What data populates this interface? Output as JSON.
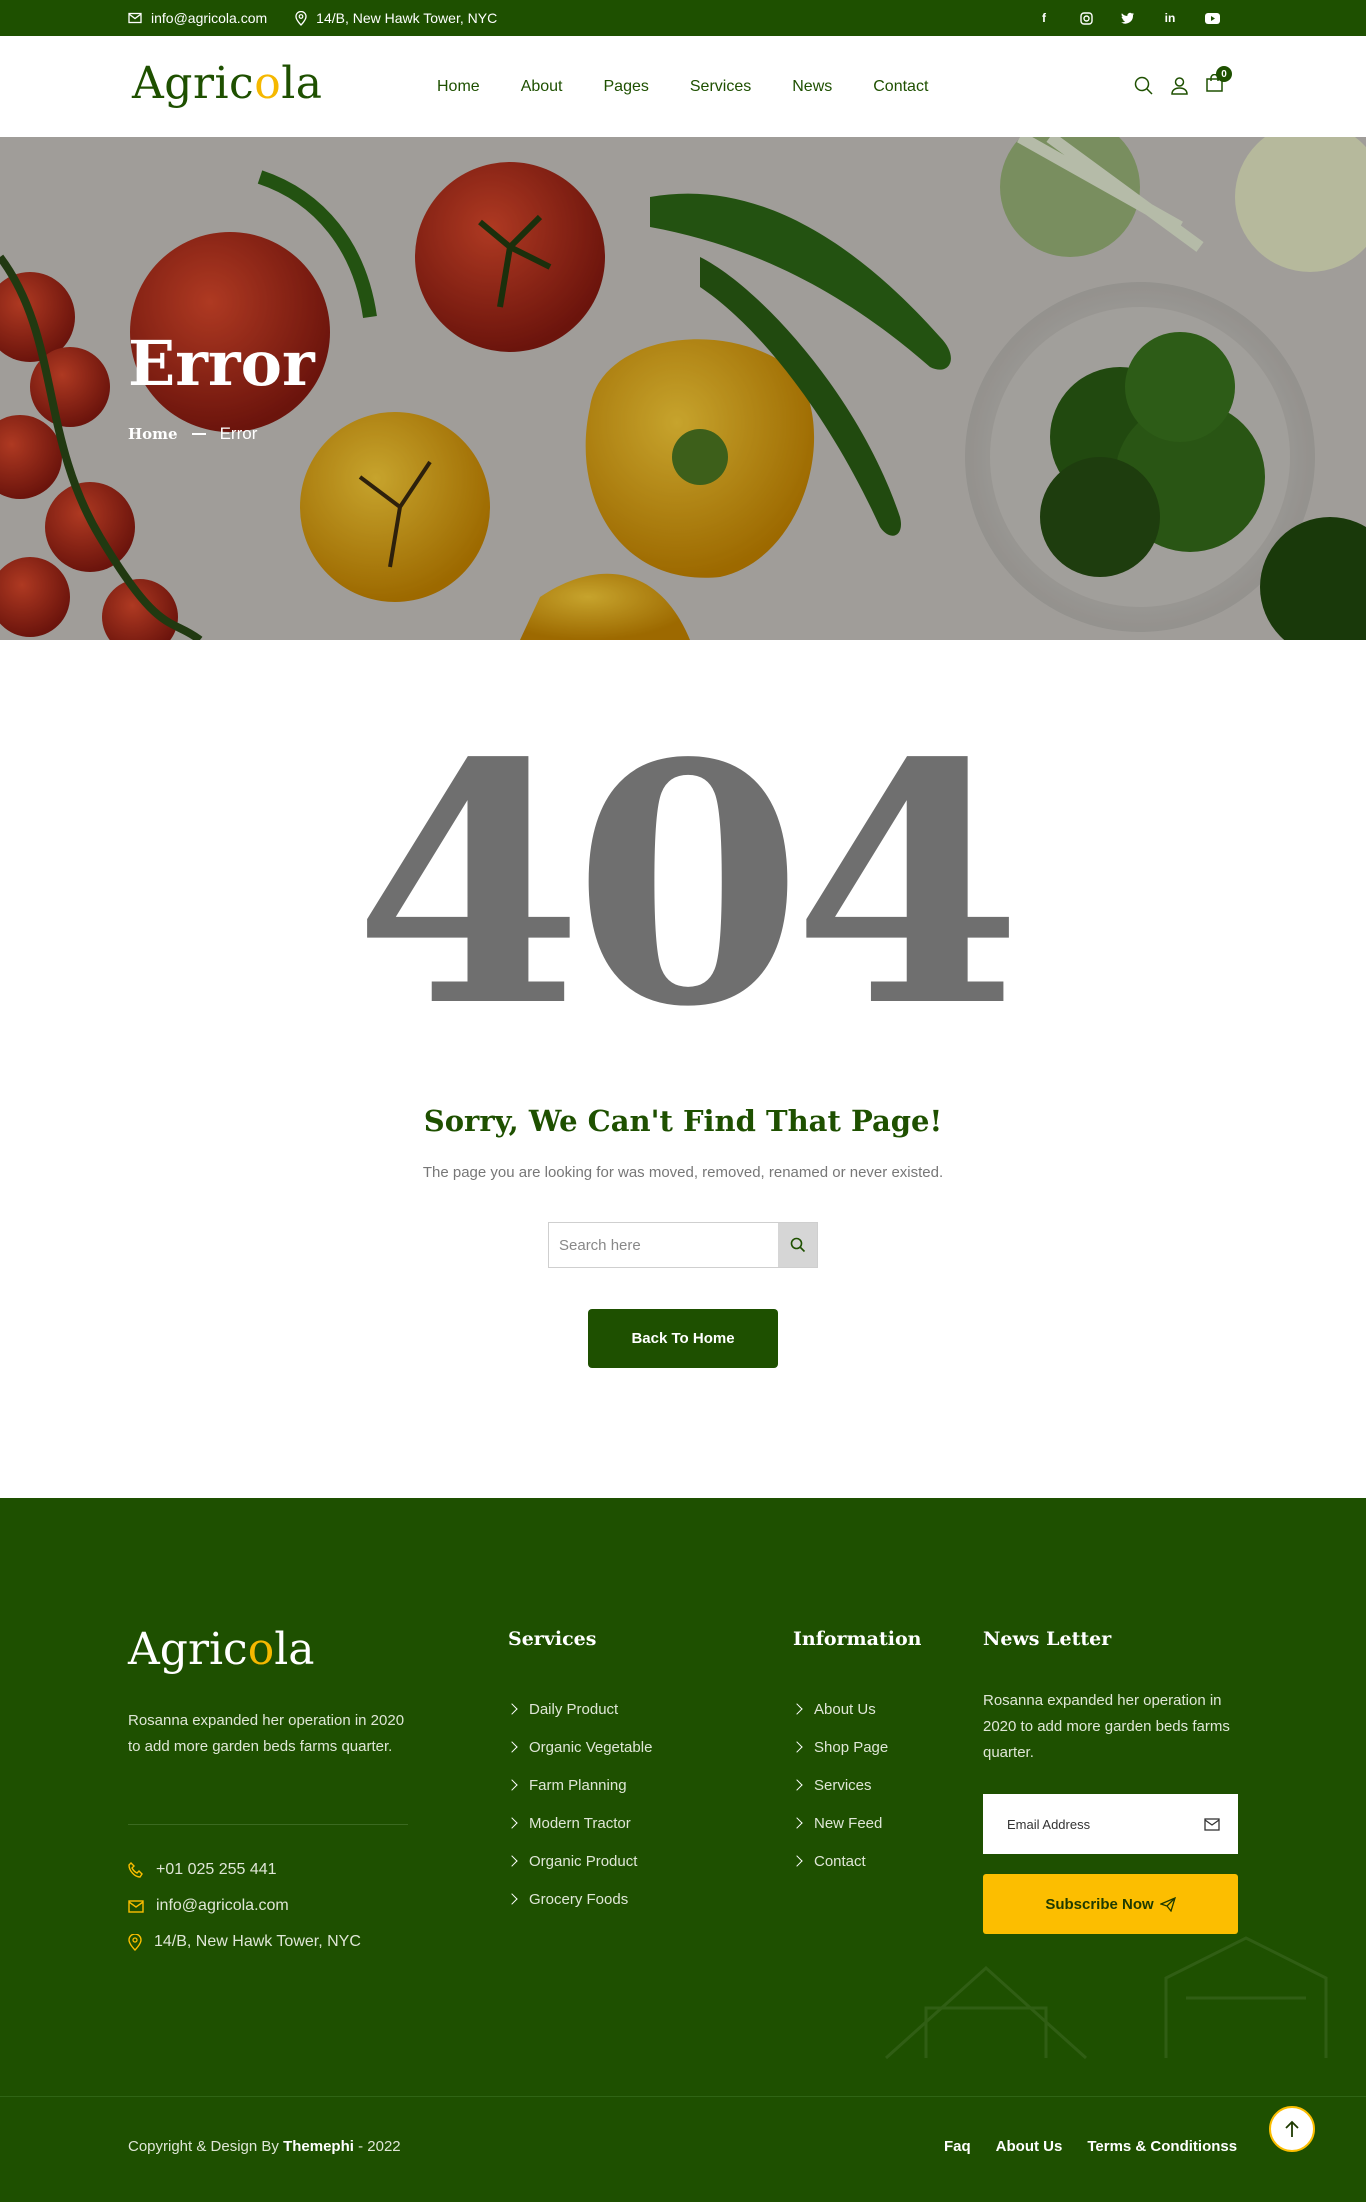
{
  "topbar": {
    "email": "info@agricola.com",
    "address": "14/B, New Hawk Tower, NYC",
    "social": [
      "facebook-icon",
      "instagram-icon",
      "twitter-icon",
      "linkedin-icon",
      "youtube-icon"
    ]
  },
  "header": {
    "logo_pre": "Agric",
    "logo_o": "o",
    "logo_post": "la",
    "nav": [
      "Home",
      "About",
      "Pages",
      "Services",
      "News",
      "Contact"
    ],
    "cart_count": "0"
  },
  "hero": {
    "title": "Error",
    "crumb_home": "Home",
    "crumb_current": "Error"
  },
  "error": {
    "code": "404",
    "heading": "Sorry, We Can't Find That Page!",
    "description": "The page you are looking for was moved, removed, renamed or never existed.",
    "search_placeholder": "Search here",
    "back_button": "Back To Home"
  },
  "footer": {
    "about": "Rosanna expanded her operation in 2020 to add more garden beds farms quarter.",
    "phone": "+01 025 255 441",
    "email": "info@agricola.com",
    "address": "14/B, New Hawk Tower, NYC",
    "services_title": "Services",
    "services": [
      "Daily Product",
      "Organic Vegetable",
      "Farm Planning",
      "Modern Tractor",
      "Organic Product",
      "Grocery Foods"
    ],
    "info_title": "Information",
    "info": [
      "About Us",
      "Shop Page",
      "Services",
      "New Feed",
      "Contact"
    ],
    "news_title": "News Letter",
    "news_desc": "Rosanna expanded her operation in 2020 to add more garden beds farms quarter.",
    "email_placeholder": "Email Address",
    "subscribe": "Subscribe Now",
    "copy_pre": "Copyright & Design By",
    "copy_brand": "Themephi",
    "copy_post": "- 2022",
    "bottom_links": [
      "Faq",
      "About Us",
      "Terms & Conditionss"
    ]
  },
  "colors": {
    "primary": "#1e5000",
    "accent": "#fcbe00"
  }
}
